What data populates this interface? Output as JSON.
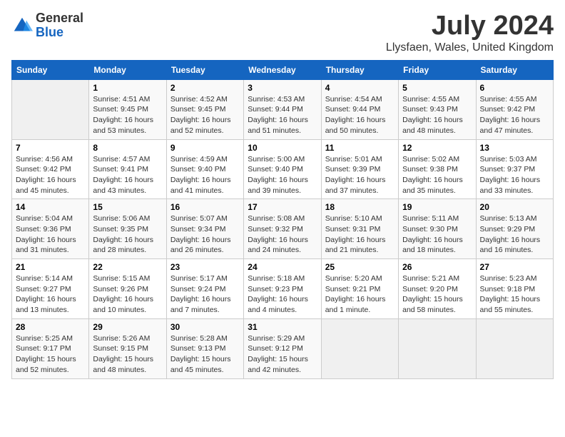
{
  "header": {
    "logo_line1": "General",
    "logo_line2": "Blue",
    "title": "July 2024",
    "subtitle": "Llysfaen, Wales, United Kingdom"
  },
  "weekdays": [
    "Sunday",
    "Monday",
    "Tuesday",
    "Wednesday",
    "Thursday",
    "Friday",
    "Saturday"
  ],
  "weeks": [
    [
      {
        "day": "",
        "empty": true
      },
      {
        "day": "1",
        "sunrise": "4:51 AM",
        "sunset": "9:45 PM",
        "daylight": "16 hours and 53 minutes."
      },
      {
        "day": "2",
        "sunrise": "4:52 AM",
        "sunset": "9:45 PM",
        "daylight": "16 hours and 52 minutes."
      },
      {
        "day": "3",
        "sunrise": "4:53 AM",
        "sunset": "9:44 PM",
        "daylight": "16 hours and 51 minutes."
      },
      {
        "day": "4",
        "sunrise": "4:54 AM",
        "sunset": "9:44 PM",
        "daylight": "16 hours and 50 minutes."
      },
      {
        "day": "5",
        "sunrise": "4:55 AM",
        "sunset": "9:43 PM",
        "daylight": "16 hours and 48 minutes."
      },
      {
        "day": "6",
        "sunrise": "4:55 AM",
        "sunset": "9:42 PM",
        "daylight": "16 hours and 47 minutes."
      }
    ],
    [
      {
        "day": "7",
        "sunrise": "4:56 AM",
        "sunset": "9:42 PM",
        "daylight": "16 hours and 45 minutes."
      },
      {
        "day": "8",
        "sunrise": "4:57 AM",
        "sunset": "9:41 PM",
        "daylight": "16 hours and 43 minutes."
      },
      {
        "day": "9",
        "sunrise": "4:59 AM",
        "sunset": "9:40 PM",
        "daylight": "16 hours and 41 minutes."
      },
      {
        "day": "10",
        "sunrise": "5:00 AM",
        "sunset": "9:40 PM",
        "daylight": "16 hours and 39 minutes."
      },
      {
        "day": "11",
        "sunrise": "5:01 AM",
        "sunset": "9:39 PM",
        "daylight": "16 hours and 37 minutes."
      },
      {
        "day": "12",
        "sunrise": "5:02 AM",
        "sunset": "9:38 PM",
        "daylight": "16 hours and 35 minutes."
      },
      {
        "day": "13",
        "sunrise": "5:03 AM",
        "sunset": "9:37 PM",
        "daylight": "16 hours and 33 minutes."
      }
    ],
    [
      {
        "day": "14",
        "sunrise": "5:04 AM",
        "sunset": "9:36 PM",
        "daylight": "16 hours and 31 minutes."
      },
      {
        "day": "15",
        "sunrise": "5:06 AM",
        "sunset": "9:35 PM",
        "daylight": "16 hours and 28 minutes."
      },
      {
        "day": "16",
        "sunrise": "5:07 AM",
        "sunset": "9:34 PM",
        "daylight": "16 hours and 26 minutes."
      },
      {
        "day": "17",
        "sunrise": "5:08 AM",
        "sunset": "9:32 PM",
        "daylight": "16 hours and 24 minutes."
      },
      {
        "day": "18",
        "sunrise": "5:10 AM",
        "sunset": "9:31 PM",
        "daylight": "16 hours and 21 minutes."
      },
      {
        "day": "19",
        "sunrise": "5:11 AM",
        "sunset": "9:30 PM",
        "daylight": "16 hours and 18 minutes."
      },
      {
        "day": "20",
        "sunrise": "5:13 AM",
        "sunset": "9:29 PM",
        "daylight": "16 hours and 16 minutes."
      }
    ],
    [
      {
        "day": "21",
        "sunrise": "5:14 AM",
        "sunset": "9:27 PM",
        "daylight": "16 hours and 13 minutes."
      },
      {
        "day": "22",
        "sunrise": "5:15 AM",
        "sunset": "9:26 PM",
        "daylight": "16 hours and 10 minutes."
      },
      {
        "day": "23",
        "sunrise": "5:17 AM",
        "sunset": "9:24 PM",
        "daylight": "16 hours and 7 minutes."
      },
      {
        "day": "24",
        "sunrise": "5:18 AM",
        "sunset": "9:23 PM",
        "daylight": "16 hours and 4 minutes."
      },
      {
        "day": "25",
        "sunrise": "5:20 AM",
        "sunset": "9:21 PM",
        "daylight": "16 hours and 1 minute."
      },
      {
        "day": "26",
        "sunrise": "5:21 AM",
        "sunset": "9:20 PM",
        "daylight": "15 hours and 58 minutes."
      },
      {
        "day": "27",
        "sunrise": "5:23 AM",
        "sunset": "9:18 PM",
        "daylight": "15 hours and 55 minutes."
      }
    ],
    [
      {
        "day": "28",
        "sunrise": "5:25 AM",
        "sunset": "9:17 PM",
        "daylight": "15 hours and 52 minutes."
      },
      {
        "day": "29",
        "sunrise": "5:26 AM",
        "sunset": "9:15 PM",
        "daylight": "15 hours and 48 minutes."
      },
      {
        "day": "30",
        "sunrise": "5:28 AM",
        "sunset": "9:13 PM",
        "daylight": "15 hours and 45 minutes."
      },
      {
        "day": "31",
        "sunrise": "5:29 AM",
        "sunset": "9:12 PM",
        "daylight": "15 hours and 42 minutes."
      },
      {
        "day": "",
        "empty": true
      },
      {
        "day": "",
        "empty": true
      },
      {
        "day": "",
        "empty": true
      }
    ]
  ]
}
